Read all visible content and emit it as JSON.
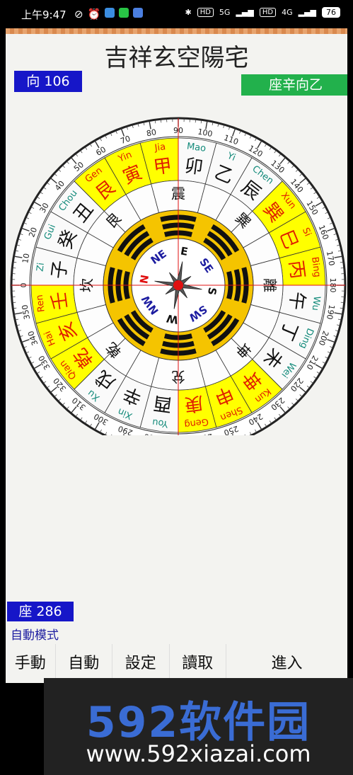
{
  "status_bar": {
    "time": "上午9:47",
    "battery": "76",
    "network_1": "5G",
    "network_2": "4G",
    "hd": "HD"
  },
  "title": "吉祥玄空陽宅",
  "direction_label": "向 106",
  "seat_direction": "座辛向乙",
  "seat_degree": "座 286",
  "mode_label": "自動模式",
  "buttons": [
    "手動",
    "自動",
    "設定",
    "讀取",
    "進入"
  ],
  "compass": {
    "degree_labels": [
      "0",
      "10",
      "20",
      "30",
      "40",
      "50",
      "60",
      "70",
      "80",
      "90",
      "100",
      "110",
      "120",
      "130",
      "140",
      "150",
      "160",
      "170",
      "180",
      "190",
      "200",
      "210",
      "220",
      "230",
      "240",
      "250",
      "260",
      "270",
      "280",
      "290",
      "300",
      "310",
      "320",
      "330",
      "340",
      "350"
    ],
    "mountains": [
      {
        "char": "卯",
        "pinyin": "Mao",
        "highlight": false
      },
      {
        "char": "乙",
        "pinyin": "Yi",
        "highlight": false
      },
      {
        "char": "辰",
        "pinyin": "Chen",
        "highlight": false
      },
      {
        "char": "巽",
        "pinyin": "Xun",
        "highlight": true
      },
      {
        "char": "巳",
        "pinyin": "Si",
        "highlight": true
      },
      {
        "char": "丙",
        "pinyin": "Bing",
        "highlight": true
      },
      {
        "char": "午",
        "pinyin": "Wu",
        "highlight": false
      },
      {
        "char": "丁",
        "pinyin": "Ding",
        "highlight": false
      },
      {
        "char": "未",
        "pinyin": "Wei",
        "highlight": false
      },
      {
        "char": "坤",
        "pinyin": "Kun",
        "highlight": true
      },
      {
        "char": "申",
        "pinyin": "Shen",
        "highlight": true
      },
      {
        "char": "庚",
        "pinyin": "Geng",
        "highlight": true
      },
      {
        "char": "酉",
        "pinyin": "You",
        "highlight": false
      },
      {
        "char": "辛",
        "pinyin": "Xin",
        "highlight": false
      },
      {
        "char": "戌",
        "pinyin": "Xu",
        "highlight": false
      },
      {
        "char": "乾",
        "pinyin": "Qian",
        "highlight": true
      },
      {
        "char": "亥",
        "pinyin": "Hai",
        "highlight": true
      },
      {
        "char": "壬",
        "pinyin": "Ren",
        "highlight": true
      },
      {
        "char": "子",
        "pinyin": "Zi",
        "highlight": false
      },
      {
        "char": "癸",
        "pinyin": "Gui",
        "highlight": false
      },
      {
        "char": "丑",
        "pinyin": "Chou",
        "highlight": false
      },
      {
        "char": "艮",
        "pinyin": "Gen",
        "highlight": true
      },
      {
        "char": "寅",
        "pinyin": "Yin",
        "highlight": true
      },
      {
        "char": "甲",
        "pinyin": "Jia",
        "highlight": true
      }
    ],
    "trigrams": [
      {
        "name": "震"
      },
      {
        "name": "巽"
      },
      {
        "name": "離"
      },
      {
        "name": "坤"
      },
      {
        "name": "兌"
      },
      {
        "name": "乾"
      },
      {
        "name": "坎"
      },
      {
        "name": "艮"
      }
    ],
    "inner_directions": [
      "E",
      "SE",
      "S",
      "SW",
      "W",
      "NW",
      "N",
      "NE"
    ],
    "north_color": "#e01010",
    "highlight_color": "#ffff00",
    "red_text_color": "#e02000",
    "teal_text_color": "#128a7a"
  },
  "watermark": {
    "logo": "592软件园",
    "url": "www.592xiazai.com"
  }
}
